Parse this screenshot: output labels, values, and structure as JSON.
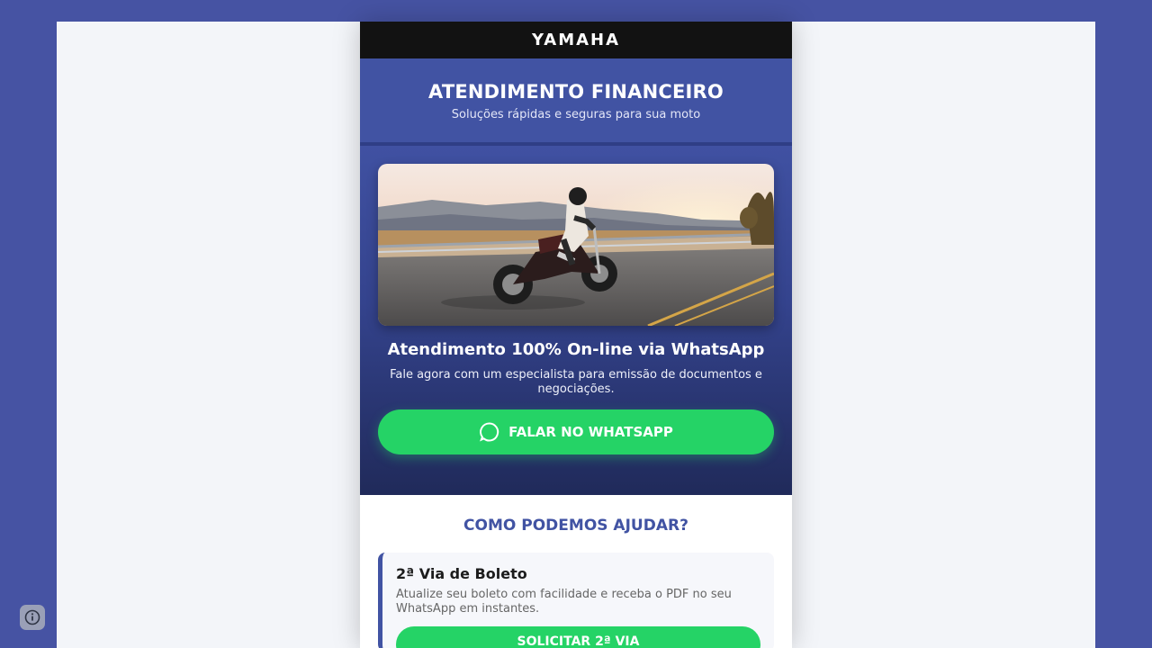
{
  "brand": {
    "name": "YAMAHA"
  },
  "header": {
    "title": "ATENDIMENTO FINANCEIRO",
    "subtitle": "Soluções rápidas e seguras para sua moto"
  },
  "hero": {
    "image_icon": "motorcycle-photo",
    "title": "Atendimento 100% On-line via WhatsApp",
    "description": "Fale agora com um especialista para emissão de documentos e negociações.",
    "button_label": "FALAR NO WHATSAPP",
    "button_icon": "whatsapp-icon"
  },
  "help": {
    "title": "COMO PODEMOS AJUDAR?",
    "cards": [
      {
        "title": "2ª Via de Boleto",
        "description": "Atualize seu boleto com facilidade e receba o PDF no seu WhatsApp em instantes.",
        "button_label": "SOLICITAR 2ª VIA"
      }
    ]
  },
  "colors": {
    "background": "#4653a3",
    "primary": "#4153a3",
    "whatsapp_green": "#25d366",
    "brand_bar": "#121212"
  },
  "floating": {
    "info_icon": "info-icon"
  }
}
